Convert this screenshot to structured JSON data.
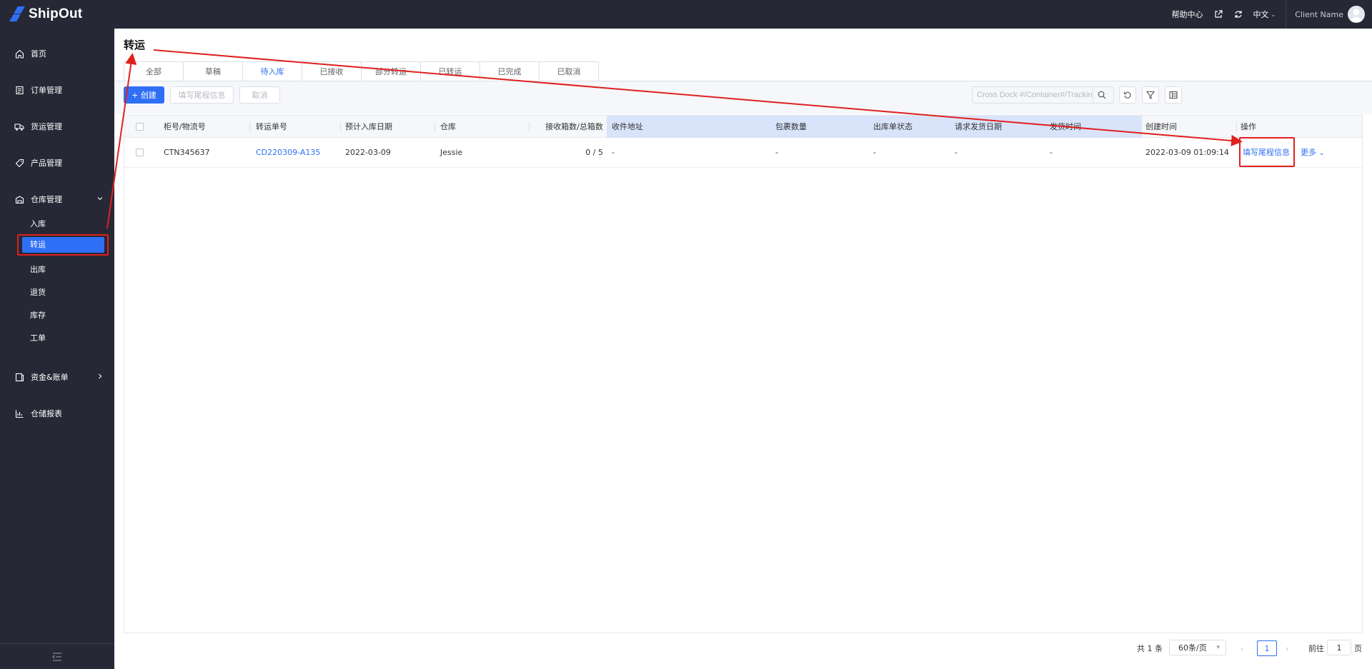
{
  "app": {
    "logo_text": "ShipOut"
  },
  "header": {
    "help_center": "帮助中心",
    "language": "中文",
    "client_name": "Client Name"
  },
  "sidebar": {
    "items": [
      {
        "label": "首页",
        "icon": "home-icon"
      },
      {
        "label": "订单管理",
        "icon": "order-icon"
      },
      {
        "label": "货运管理",
        "icon": "truck-icon"
      },
      {
        "label": "产品管理",
        "icon": "tag-icon"
      },
      {
        "label": "仓库管理",
        "icon": "warehouse-icon"
      },
      {
        "label": "资金&账单",
        "icon": "bill-icon"
      },
      {
        "label": "仓储报表",
        "icon": "report-icon"
      }
    ],
    "warehouse_sub": [
      "入库",
      "转运",
      "出库",
      "退货",
      "库存",
      "工单"
    ],
    "active_sub": "转运"
  },
  "page": {
    "title": "转运"
  },
  "tabs": [
    {
      "label": "全部"
    },
    {
      "label": "草稿"
    },
    {
      "label": "待入库",
      "active": true
    },
    {
      "label": "已接收"
    },
    {
      "label": "部分转运"
    },
    {
      "label": "已转运"
    },
    {
      "label": "已完成"
    },
    {
      "label": "已取消"
    }
  ],
  "toolbar": {
    "create_label": "+ 创建",
    "fill_label": "填写尾程信息",
    "cancel_label": "取消",
    "search_placeholder": "Cross Dock #/Container#/Tracking"
  },
  "table": {
    "columns": [
      "柜号/物流号",
      "转运单号",
      "预计入库日期",
      "仓库",
      "接收箱数/总箱数",
      "收件地址",
      "包裹数量",
      "出库单状态",
      "请求发货日期",
      "发货时间",
      "创建时间",
      "操作"
    ],
    "rows": [
      {
        "container_no": "CTN345637",
        "order_no": "CD220309-A135",
        "eta": "2022-03-09",
        "warehouse": "Jessie",
        "boxes": "0 / 5",
        "address": "-",
        "package_count": "-",
        "outbound_status": "-",
        "request_date": "-",
        "ship_time": "-",
        "created_at": "2022-03-09 01:09:14",
        "action_fill": "填写尾程信息",
        "action_more": "更多"
      }
    ]
  },
  "pagination": {
    "total": "共 1 条",
    "page_size": "60条/页",
    "current_page": "1",
    "goto_label": "前往",
    "goto_value": "1",
    "page_suffix": "页"
  },
  "colors": {
    "accent": "#2f6ff5",
    "sidebar_bg": "#262836",
    "annotation_red": "#e0201e"
  }
}
